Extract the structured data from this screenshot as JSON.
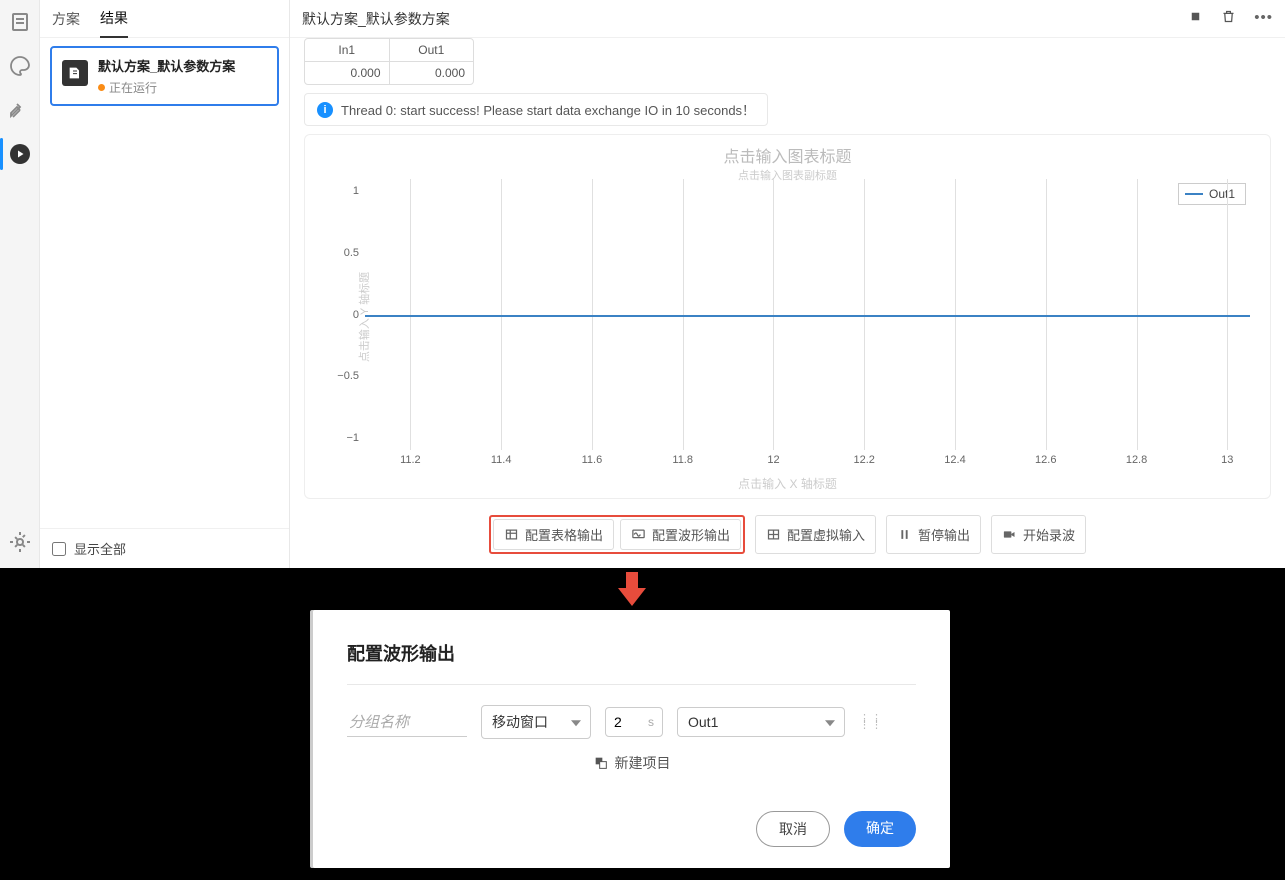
{
  "title": "默认方案_默认参数方案",
  "side_tabs": {
    "plan": "方案",
    "result": "结果"
  },
  "case": {
    "title": "默认方案_默认参数方案",
    "status": "正在运行"
  },
  "show_all": "显示全部",
  "small_table": {
    "h1": "In1",
    "h2": "Out1",
    "v1": "0.000",
    "v2": "0.000"
  },
  "alert": "Thread 0: start success! Please start data exchange IO in 10 seconds！",
  "toolbar": {
    "table_out": "配置表格输出",
    "wave_out": "配置波形输出",
    "virtual_in": "配置虚拟输入",
    "pause": "暂停输出",
    "record": "开始录波"
  },
  "chart": {
    "title": "点击输入图表标题",
    "subtitle": "点击输入图表副标题",
    "ylabel": "点击输入 Y 轴标题",
    "xlabel": "点击输入 X 轴标题",
    "legend": "Out1"
  },
  "chart_data": {
    "type": "line",
    "series": [
      {
        "name": "Out1",
        "values": [
          0,
          0,
          0,
          0,
          0,
          0,
          0,
          0,
          0,
          0
        ]
      }
    ],
    "x": [
      11.2,
      11.4,
      11.6,
      11.8,
      12,
      12.2,
      12.4,
      12.6,
      12.8,
      13
    ],
    "xlim": [
      11.1,
      13.05
    ],
    "ylim": [
      -1.1,
      1.1
    ],
    "yticks": [
      -1,
      -0.5,
      0,
      0.5,
      1
    ],
    "xticks": [
      11.2,
      11.4,
      11.6,
      11.8,
      12,
      12.2,
      12.4,
      12.6,
      12.8,
      13
    ],
    "title": "点击输入图表标题",
    "xlabel": "点击输入 X 轴标题",
    "ylabel": "点击输入 Y 轴标题"
  },
  "dialog": {
    "title": "配置波形输出",
    "group_placeholder": "分组名称",
    "window_mode": "移动窗口",
    "duration": "2",
    "unit": "s",
    "channel": "Out1",
    "new_item": "新建项目",
    "cancel": "取消",
    "ok": "确定"
  }
}
